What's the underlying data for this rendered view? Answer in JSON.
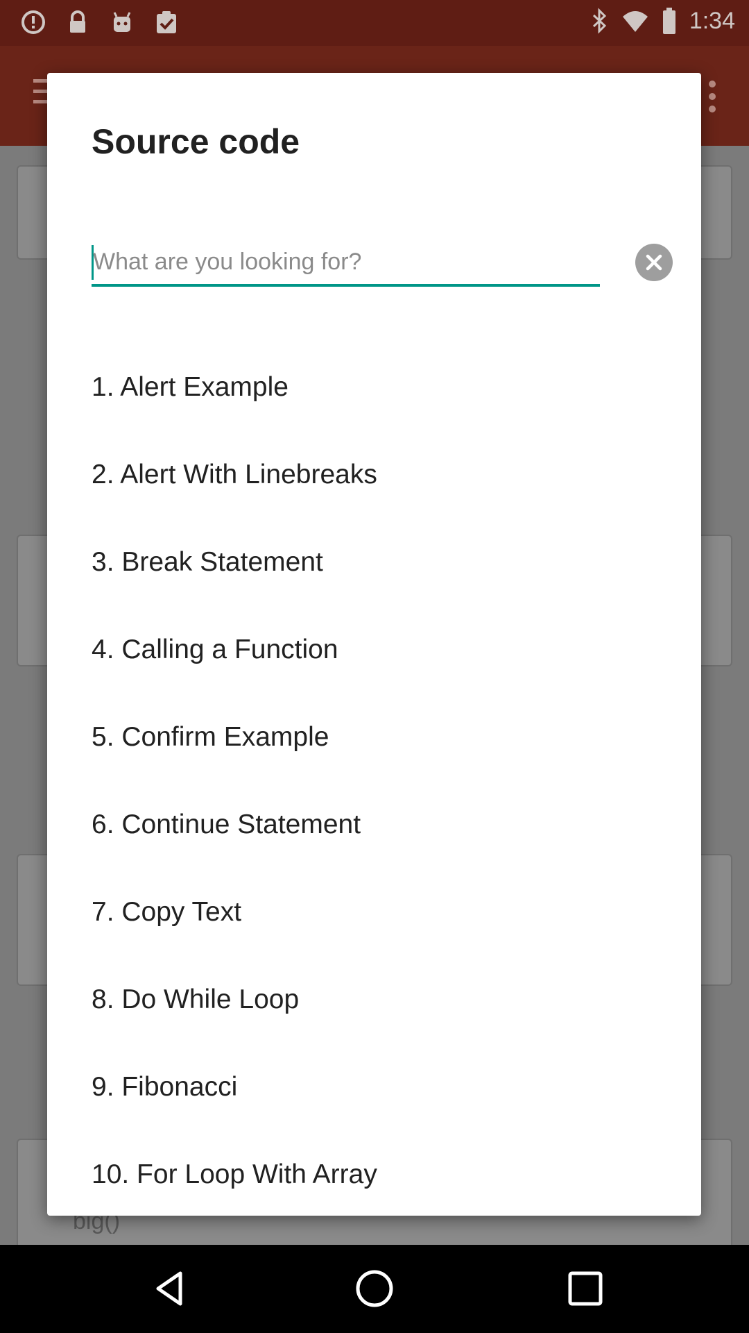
{
  "status_bar": {
    "time": "1:34",
    "left_icons": [
      "alert-circle-icon",
      "lock-icon",
      "android-icon",
      "clipboard-check-icon"
    ],
    "right_icons": [
      "bluetooth-icon",
      "wifi-icon",
      "battery-icon"
    ]
  },
  "dialog": {
    "title": "Source code",
    "search": {
      "placeholder": "What are you looking for?",
      "value": ""
    },
    "items": [
      {
        "label": "1. Alert Example"
      },
      {
        "label": "2. Alert With Linebreaks"
      },
      {
        "label": "3. Break Statement"
      },
      {
        "label": "4. Calling a Function"
      },
      {
        "label": "5. Confirm Example"
      },
      {
        "label": "6. Continue Statement"
      },
      {
        "label": "7. Copy Text"
      },
      {
        "label": "8. Do While Loop"
      },
      {
        "label": "9. Fibonacci"
      },
      {
        "label": "10. For Loop With Array"
      }
    ]
  },
  "background": {
    "partial_text": "big()"
  },
  "colors": {
    "accent": "#009688",
    "status_bar": "#5f1d14",
    "scrim_bg": "#7b7b7b"
  },
  "nav_bar": {
    "buttons": [
      "back-icon",
      "home-icon",
      "recents-icon"
    ]
  }
}
